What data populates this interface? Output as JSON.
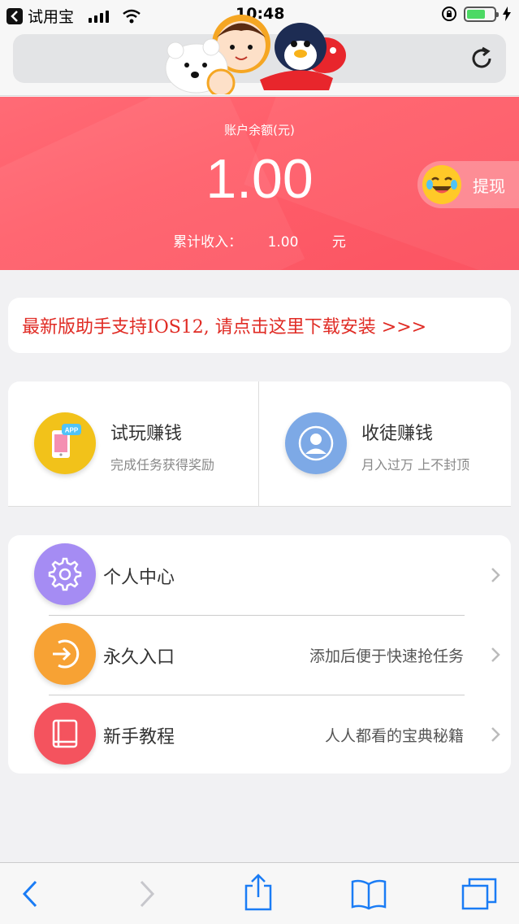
{
  "status_bar": {
    "back_app": "试用宝",
    "time": "10:48"
  },
  "hero": {
    "label": "账户余额(元)",
    "balance": "1.00",
    "total_label": "累计收入：",
    "total_value": "1.00",
    "total_unit": "元",
    "withdraw_label": "提现"
  },
  "notice": {
    "text": "最新版助手支持IOS12, 请点击这里下载安装 >>>"
  },
  "earn": [
    {
      "title": "试玩赚钱",
      "subtitle": "完成任务获得奖励",
      "icon": "phone-app-icon",
      "color": "#f2c21a"
    },
    {
      "title": "收徒赚钱",
      "subtitle": "月入过万 上不封顶",
      "icon": "person-icon",
      "color": "#7da9e6"
    }
  ],
  "menu": [
    {
      "label": "个人中心",
      "desc": "",
      "icon": "gear-icon",
      "color": "#a58cf3"
    },
    {
      "label": "永久入口",
      "desc": "添加后便于快速抢任务",
      "icon": "enter-arrow-icon",
      "color": "#f7a234"
    },
    {
      "label": "新手教程",
      "desc": "人人都看的宝典秘籍",
      "icon": "book-icon",
      "color": "#f4535e"
    }
  ],
  "colors": {
    "hero": "#ff5e6a",
    "notice_text": "#e02b24",
    "toolbar_icon": "#1a7cf5"
  }
}
